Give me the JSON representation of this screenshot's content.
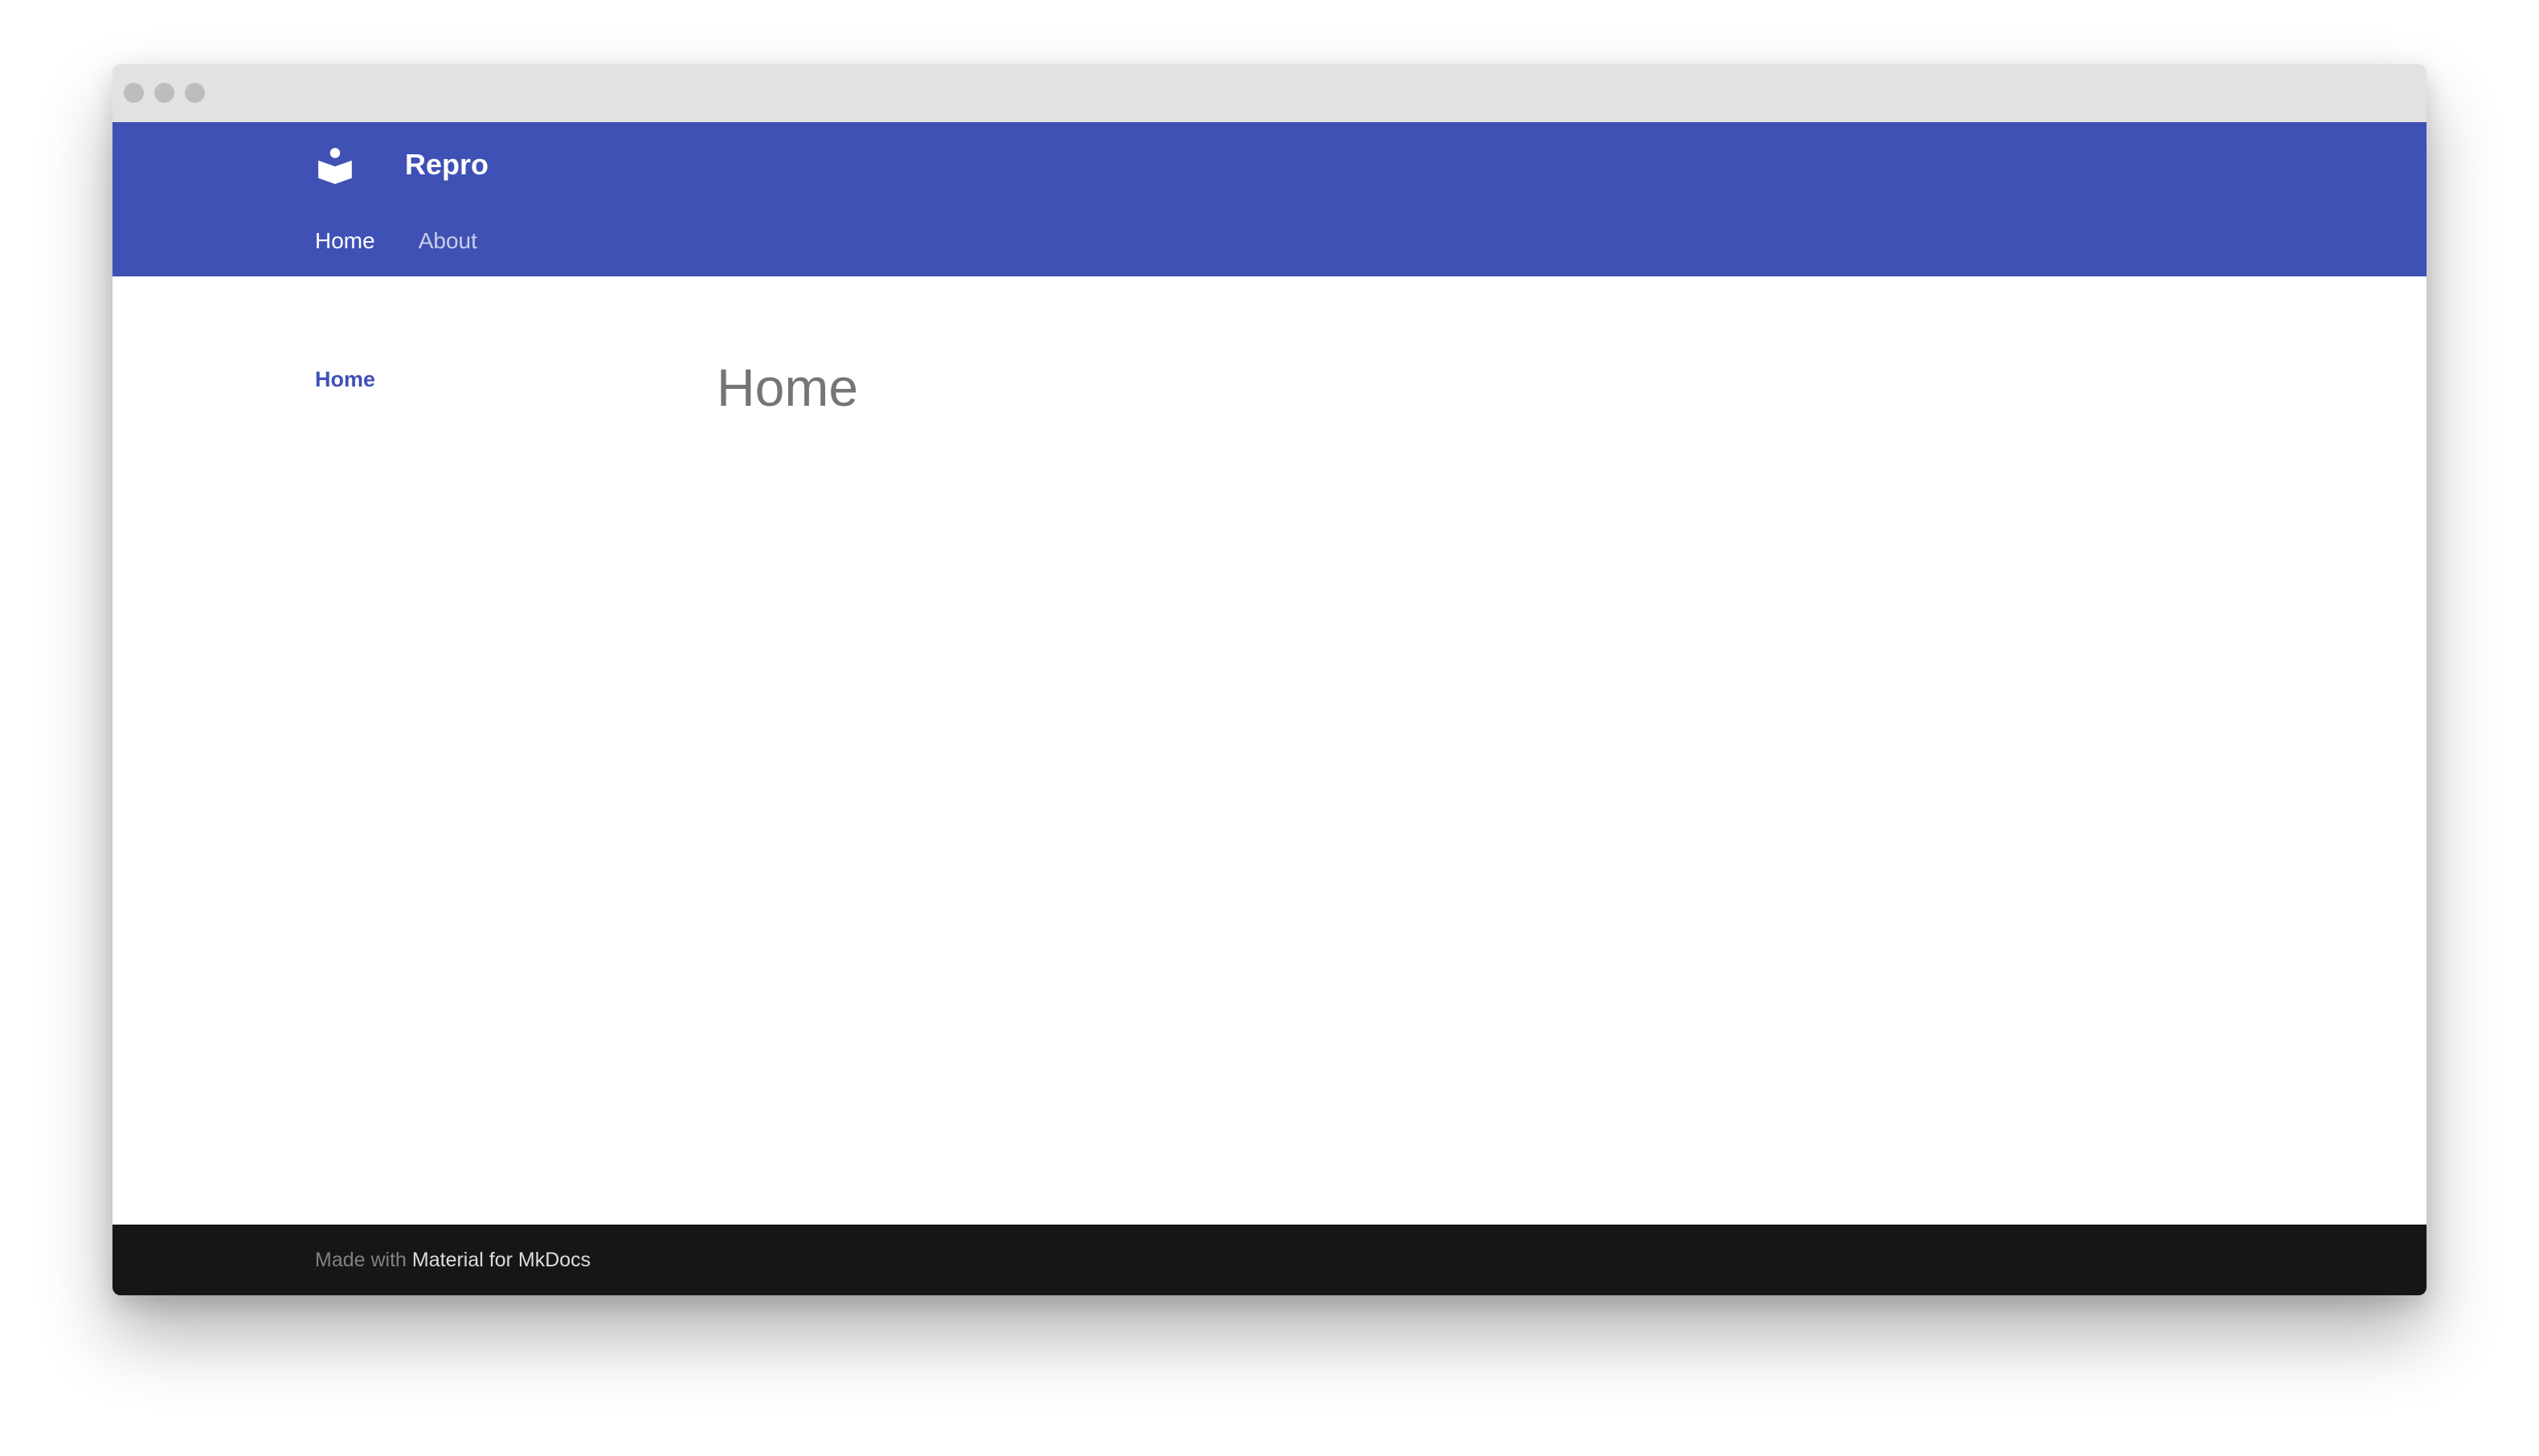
{
  "window": {
    "controls": [
      "close",
      "minimize",
      "maximize"
    ]
  },
  "header": {
    "logo_icon": "book-reader-icon",
    "site_title": "Repro",
    "brand_color": "#3f51b5"
  },
  "tabs": [
    {
      "label": "Home",
      "active": true
    },
    {
      "label": "About",
      "active": false
    }
  ],
  "sidebar": {
    "items": [
      {
        "label": "Home",
        "active": true
      }
    ]
  },
  "content": {
    "title": "Home"
  },
  "footer": {
    "prefix": "Made with ",
    "link_label": "Material for MkDocs"
  }
}
